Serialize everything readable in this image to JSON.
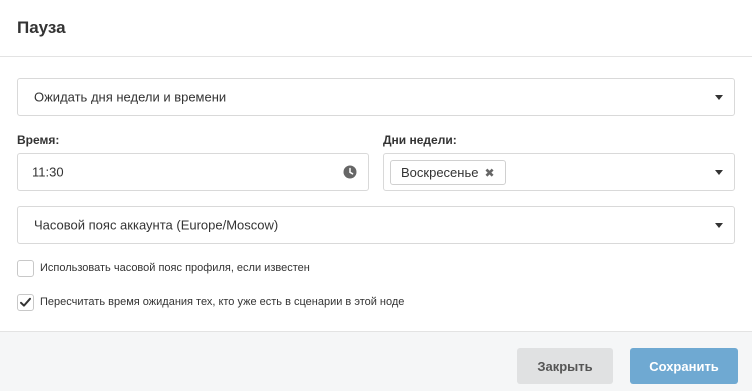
{
  "dialog": {
    "title": "Пауза"
  },
  "mode_select": {
    "value": "Ожидать дня недели и времени"
  },
  "time": {
    "label": "Время:",
    "value": "11:30",
    "icon": "clock-icon"
  },
  "weekdays": {
    "label": "Дни недели:",
    "tags": [
      "Воскресенье"
    ],
    "remove_glyph": "✖"
  },
  "timezone_select": {
    "value": "Часовой пояс аккаунта (Europe/Moscow)"
  },
  "options": [
    {
      "label": "Использовать часовой пояс профиля, если известен",
      "checked": false
    },
    {
      "label": "Пересчитать время ожидания тех, кто уже есть в сценарии в этой ноде",
      "checked": true
    }
  ],
  "footer": {
    "close_label": "Закрыть",
    "save_label": "Сохранить"
  },
  "colors": {
    "primary_button": "#6fa9d2",
    "secondary_button": "#e0e1e2",
    "footer_bg": "#f5f6f7"
  }
}
